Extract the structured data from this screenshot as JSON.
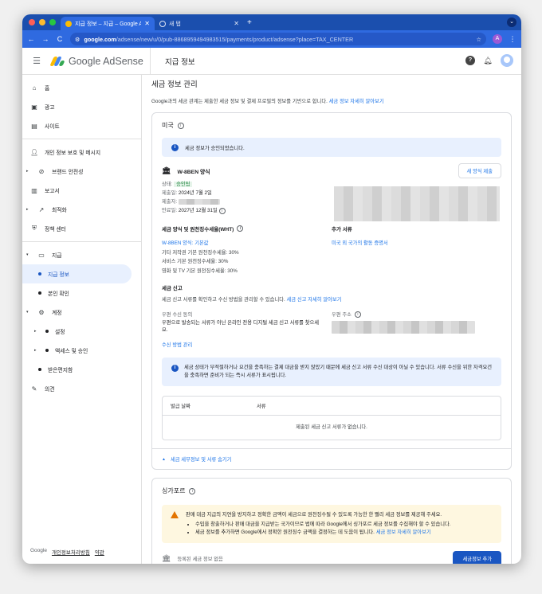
{
  "browser": {
    "tabs": [
      {
        "title": "지급 정보 – 지급 – Google AdSense",
        "active": true
      },
      {
        "title": "새 탭",
        "active": false
      }
    ],
    "new_tab": "+",
    "menu": "⌄",
    "url_host": "google.com",
    "url_path": "/adsense/new/u/0/pub-8868959494983515/payments/product/adsense?place=TAX_CENTER",
    "profile_letter": "A",
    "nav": {
      "back": "←",
      "forward": "→",
      "reload": "C",
      "tune": "⚙",
      "star": "☆",
      "more": "⋮"
    }
  },
  "header": {
    "brand": "Google AdSense",
    "page_title": "지급 정보",
    "help": "?"
  },
  "sidebar": {
    "items": [
      {
        "label": "홈",
        "icon": "home-icon"
      },
      {
        "label": "광고",
        "icon": "ads-icon"
      },
      {
        "label": "사이트",
        "icon": "sites-icon"
      },
      {
        "label": "개인 정보 보호 및 메시지",
        "icon": "privacy-icon"
      },
      {
        "label": "브랜드 안전성",
        "icon": "block-icon"
      },
      {
        "label": "보고서",
        "icon": "reports-icon"
      },
      {
        "label": "최적화",
        "icon": "trend-icon"
      },
      {
        "label": "정책 센터",
        "icon": "shield-icon"
      },
      {
        "label": "지급",
        "icon": "payments-icon"
      },
      {
        "label": "지급 정보"
      },
      {
        "label": "본인 확인"
      },
      {
        "label": "계정",
        "icon": "gear-icon"
      },
      {
        "label": "설정"
      },
      {
        "label": "액세스 및 승인"
      },
      {
        "label": "받은편지함"
      },
      {
        "label": "의견",
        "icon": "feedback-icon"
      }
    ],
    "footer": {
      "google": "Google",
      "privacy": "개인정보처리방침",
      "terms": "약관"
    }
  },
  "main": {
    "heading": "세금 정보 관리",
    "desc": "Google과의 세금 관계는 제출한 세금 정보 및 결제 프로필의 정보를 기반으로 합니다.",
    "desc_link": "세금 정보 자세히 알아보기",
    "us": {
      "country": "미국",
      "approved_banner": "세금 정보가 승인되었습니다.",
      "form_name": "W-8BEN 양식",
      "new_form_button": "새 양식 제출",
      "status_label": "상태:",
      "status_value": "승인됨",
      "submitted_label": "제출일:",
      "submitted_value": "2024년 7월 2일",
      "submitter_label": "제출자:",
      "expiry_label": "만료일:",
      "expiry_value": "2027년 12월 31일",
      "wht_title": "세금 양식 및 원천징수세율(WHT)",
      "wht_link": "W-8BEN 양식: 기본값",
      "wht_lines": [
        "기타 저작권 기본 원천징수세율: 30%",
        "서비스 기본 원천징수세율: 30%",
        "영화 및 TV 기본 원천징수세율: 30%"
      ],
      "extra_title": "추가 서류",
      "extra_link": "미국 외 국가의 활동 증명서",
      "filing_title": "세금 신고",
      "filing_desc": "세금 신고 서류를 확인하고 수신 방법을 관리할 수 있습니다.",
      "filing_link": "세금 신고 자세히 알아보기",
      "mail_consent_label": "우편 수신 동의",
      "mail_consent_value": "우편으로 발송되는 서류가 아닌 온라인 전용 디지털 세금 신고 서류를 찾으세요.",
      "mail_address_label": "우편 주소",
      "manage_link": "수신 방법 관리",
      "notice": "세금 상태가 부적절하거나 요건을 충족하는 결제 대금을 받지 않았기 때문에 세금 신고 서류 수신 대상이 아닐 수 있습니다. 서류 수신을 위한 자격요건을 충족하면 준비가 되는 즉시 서류가 표시됩니다.",
      "table_headers": [
        "발급 날짜",
        "서류"
      ],
      "table_empty": "제출된 세금 신고 서류가 없습니다.",
      "hide_link": "세금 세부정보 및 서류 숨기기"
    },
    "sg": {
      "country": "싱가포르",
      "warn_title": "판매 대금 지급의 지연을 방지하고 정확한 금액이 세금으로 원천징수될 수 있도록 가능한 한 빨리 세금 정보를 제공해 주세요.",
      "bullets": [
        "수입을 창출하거나 판매 대금을 지급받는 국가이므로 법에 따라 Google에서 싱가포르 세금 정보를 수집해야 할 수 있습니다.",
        "세금 정보를 추가하면 Google에서 정확한 원천징수 금액을 결정하는 데 도움이 됩니다."
      ],
      "bullet_link": "세금 정보 자세히 알아보기",
      "registered": "등록된 세금 정보 없음",
      "add_button": "세금정보 추가"
    }
  },
  "colors": {
    "brand_blue": "#1a56c2",
    "link": "#1a73e8",
    "approved_bg": "#e6f4ea",
    "approved_fg": "#188038",
    "warn": "#e37400"
  }
}
